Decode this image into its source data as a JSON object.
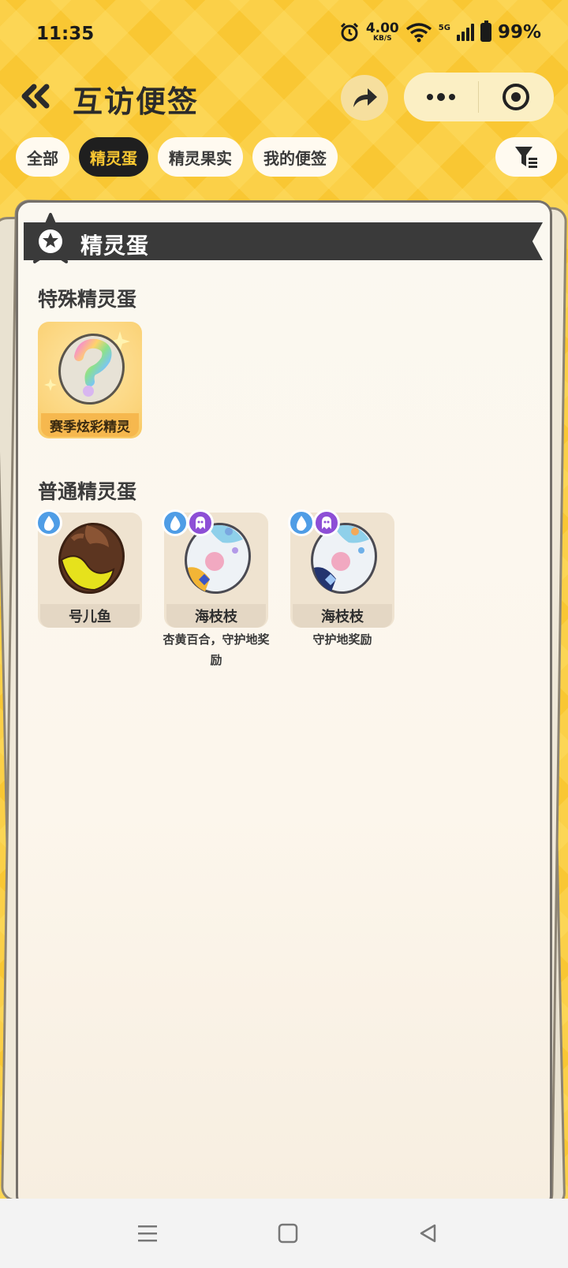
{
  "status_bar": {
    "time": "11:35",
    "net_speed": "4.00",
    "net_unit": "KB/S",
    "signal": "5G",
    "battery": "99%"
  },
  "header": {
    "title": "互访便签"
  },
  "tabs": [
    {
      "label": "全部",
      "active": false
    },
    {
      "label": "精灵蛋",
      "active": true
    },
    {
      "label": "精灵果实",
      "active": false
    },
    {
      "label": "我的便签",
      "active": false
    }
  ],
  "section": {
    "title": "精灵蛋"
  },
  "special": {
    "heading": "特殊精灵蛋",
    "items": [
      {
        "name": "赛季炫彩精灵",
        "icon": "rainbow-mystery-egg-icon"
      }
    ]
  },
  "normal": {
    "heading": "普通精灵蛋",
    "items": [
      {
        "name": "号儿鱼",
        "note": "",
        "types": [
          "water"
        ],
        "icon": "brown-yellow-egg-icon"
      },
      {
        "name": "海枝枝",
        "note": "杏黄百合，守护地奖励",
        "types": [
          "water",
          "ghost"
        ],
        "icon": "white-blue-yellow-egg-icon"
      },
      {
        "name": "海枝枝",
        "note": "守护地奖励",
        "types": [
          "water",
          "ghost"
        ],
        "icon": "white-blue-navy-egg-icon"
      }
    ]
  },
  "colors": {
    "background": "#f9c832",
    "active_tab": "#1f1f1f",
    "active_tab_text": "#f9c732",
    "panel": "#fbf8f0",
    "water_type": "#4f9de6",
    "ghost_type": "#8d4fd6"
  }
}
